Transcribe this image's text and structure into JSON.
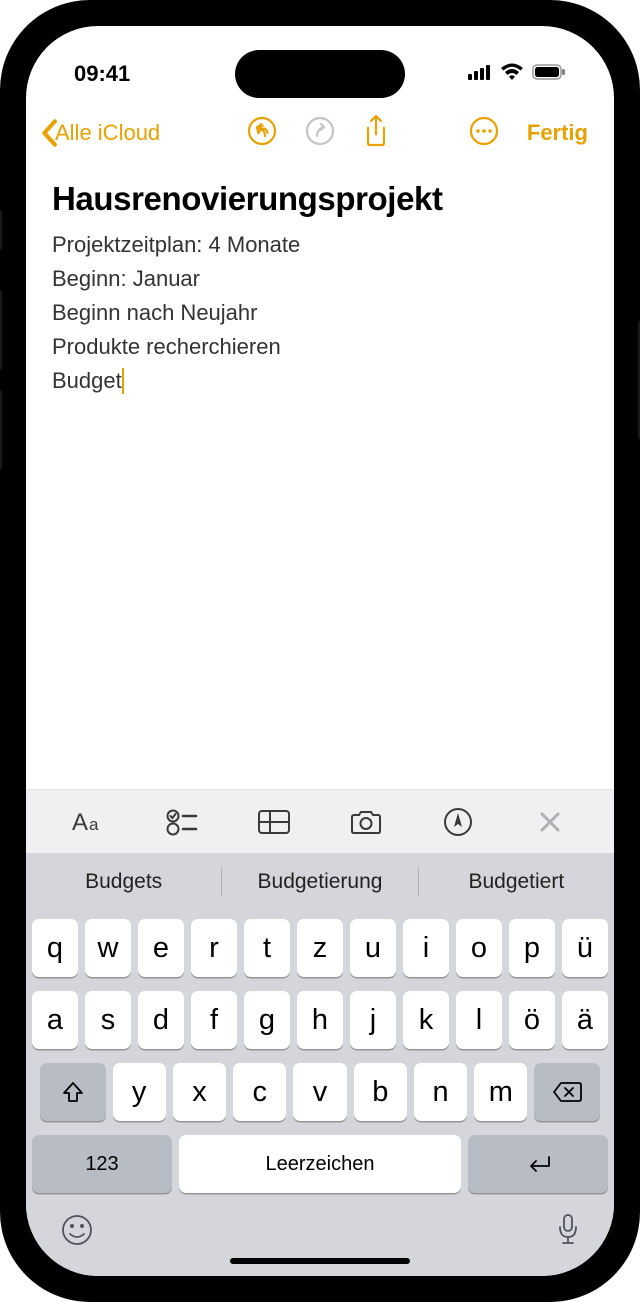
{
  "status": {
    "time": "09:41"
  },
  "nav": {
    "back_label": "Alle iCloud",
    "done": "Fertig"
  },
  "note": {
    "title": "Hausrenovierungsprojekt",
    "lines": [
      "Projektzeitplan: 4 Monate",
      "Beginn: Januar",
      "Beginn nach Neujahr",
      "Produkte recherchieren"
    ],
    "cursor_line": "Budget"
  },
  "suggestions": [
    "Budgets",
    "Budgetierung",
    "Budgetiert"
  ],
  "keyboard": {
    "row1": [
      "q",
      "w",
      "e",
      "r",
      "t",
      "z",
      "u",
      "i",
      "o",
      "p",
      "ü"
    ],
    "row2": [
      "a",
      "s",
      "d",
      "f",
      "g",
      "h",
      "j",
      "k",
      "l",
      "ö",
      "ä"
    ],
    "row3": [
      "y",
      "x",
      "c",
      "v",
      "b",
      "n",
      "m"
    ],
    "numkey": "123",
    "space": "Leerzeichen"
  }
}
